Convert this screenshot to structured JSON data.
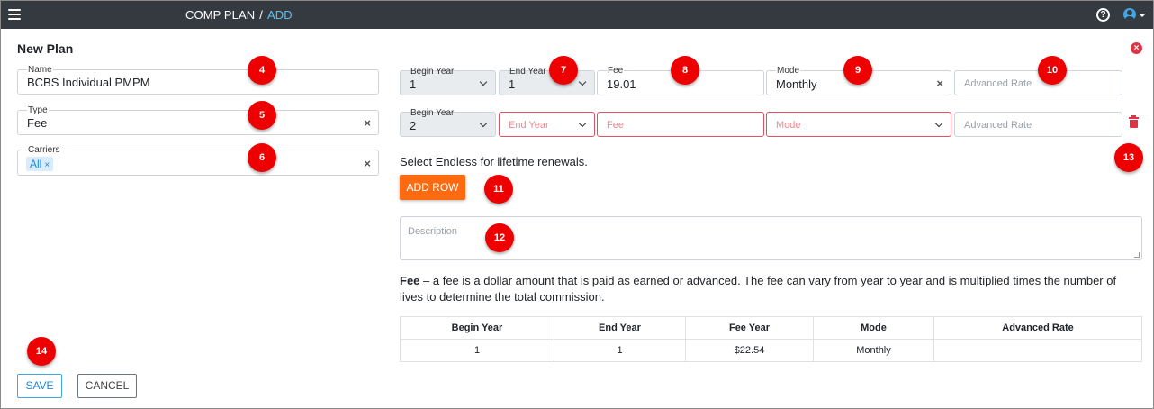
{
  "topbar": {
    "breadcrumb_root": "COMP PLAN",
    "breadcrumb_sep": "/",
    "breadcrumb_current": "ADD",
    "help_icon": "?"
  },
  "page": {
    "title": "New Plan",
    "close_icon": "×"
  },
  "left": {
    "name": {
      "label": "Name",
      "value": "BCBS Individual PMPM"
    },
    "type": {
      "label": "Type",
      "value": "Fee",
      "clear": "×"
    },
    "carriers": {
      "label": "Carriers",
      "chip": "All",
      "chip_remove": "×",
      "clear": "×"
    }
  },
  "rows": [
    {
      "begin_year": {
        "label": "Begin Year",
        "value": "1"
      },
      "end_year": {
        "label": "End Year",
        "value": "1"
      },
      "fee": {
        "label": "Fee",
        "value": "19.01"
      },
      "mode": {
        "label": "Mode",
        "value": "Monthly",
        "clear": "×"
      },
      "advanced_rate": {
        "placeholder": "Advanced Rate"
      }
    },
    {
      "begin_year": {
        "label": "Begin Year",
        "value": "2"
      },
      "end_year": {
        "placeholder": "End Year"
      },
      "fee": {
        "placeholder": "Fee"
      },
      "mode": {
        "placeholder": "Mode"
      },
      "advanced_rate": {
        "placeholder": "Advanced Rate"
      }
    }
  ],
  "hint": "Select Endless for lifetime renewals.",
  "add_row_label": "ADD ROW",
  "description": {
    "placeholder": "Description"
  },
  "explanation": {
    "term": "Fee",
    "text": " – a fee is a dollar amount that is paid as earned or advanced. The fee can vary from year to year and is multiplied times the number of lives to determine the total commission."
  },
  "table": {
    "headers": [
      "Begin Year",
      "End Year",
      "Fee Year",
      "Mode",
      "Advanced Rate"
    ],
    "rows": [
      [
        "1",
        "1",
        "$22.54",
        "Monthly",
        ""
      ]
    ]
  },
  "buttons": {
    "save": "SAVE",
    "cancel": "CANCEL"
  },
  "badges": [
    "4",
    "5",
    "6",
    "7",
    "8",
    "9",
    "10",
    "11",
    "12",
    "13",
    "14"
  ],
  "colors": {
    "topbar": "#343a40",
    "accent": "#5bc0f0",
    "add_row": "#fd6a0f",
    "badge": "#ee0000",
    "error": "#dc3545"
  }
}
